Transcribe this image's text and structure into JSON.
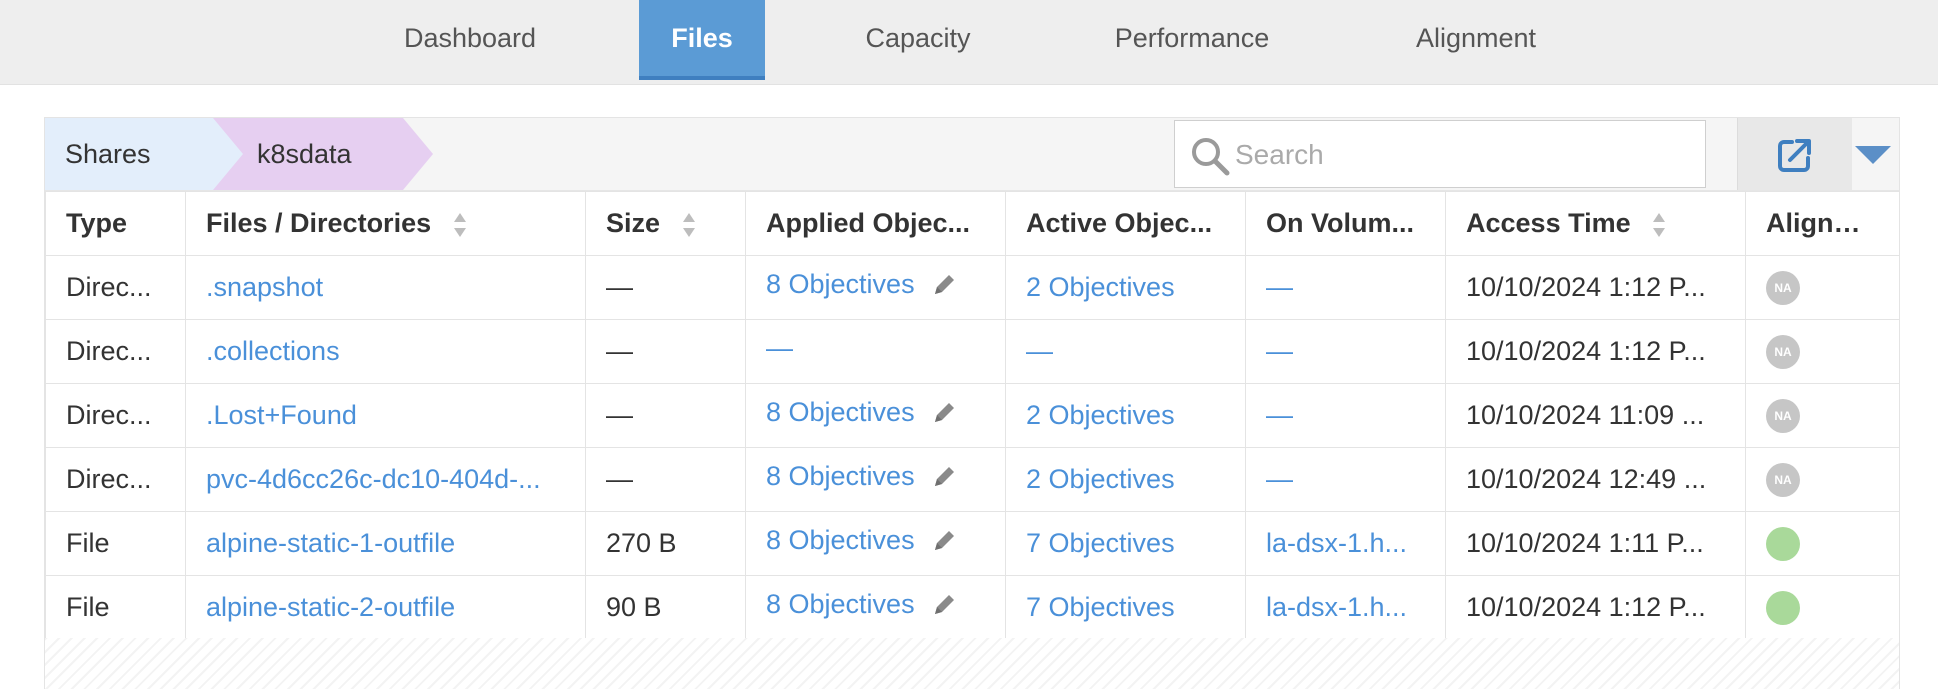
{
  "tabs": [
    {
      "label": "Dashboard",
      "active": false
    },
    {
      "label": "Files",
      "active": true
    },
    {
      "label": "Capacity",
      "active": false
    },
    {
      "label": "Performance",
      "active": false
    },
    {
      "label": "Alignment",
      "active": false
    }
  ],
  "breadcrumb": {
    "root": "Shares",
    "current": "k8sdata"
  },
  "search": {
    "placeholder": "Search",
    "value": ""
  },
  "columns": {
    "type": "Type",
    "files": "Files / Directories",
    "size": "Size",
    "applied": "Applied Objec...",
    "active": "Active Objec...",
    "on_volume": "On Volum...",
    "access_time": "Access Time",
    "alignment": "Alignm..."
  },
  "rows": [
    {
      "type": "Direc...",
      "name": ".snapshot",
      "size": "—",
      "applied": "8 Objectives",
      "active": "2 Objectives",
      "on_volume": "—",
      "access_time": "10/10/2024 1:12 P...",
      "alignment": "NA"
    },
    {
      "type": "Direc...",
      "name": ".collections",
      "size": "—",
      "applied": "—",
      "active": "—",
      "on_volume": "—",
      "access_time": "10/10/2024 1:12 P...",
      "alignment": "NA"
    },
    {
      "type": "Direc...",
      "name": ".Lost+Found",
      "size": "—",
      "applied": "8 Objectives",
      "active": "2 Objectives",
      "on_volume": "—",
      "access_time": "10/10/2024 11:09 ...",
      "alignment": "NA"
    },
    {
      "type": "Direc...",
      "name": "pvc-4d6cc26c-dc10-404d-...",
      "size": "—",
      "applied": "8 Objectives",
      "active": "2 Objectives",
      "on_volume": "—",
      "access_time": "10/10/2024 12:49 ...",
      "alignment": "NA"
    },
    {
      "type": "File",
      "name": "alpine-static-1-outfile",
      "size": "270 B",
      "applied": "8 Objectives",
      "active": "7 Objectives",
      "on_volume": "la-dsx-1.h...",
      "access_time": "10/10/2024 1:11 P...",
      "alignment": "ok"
    },
    {
      "type": "File",
      "name": "alpine-static-2-outfile",
      "size": "90 B",
      "applied": "8 Objectives",
      "active": "7 Objectives",
      "on_volume": "la-dsx-1.h...",
      "access_time": "10/10/2024 1:12 P...",
      "alignment": "ok"
    }
  ],
  "colors": {
    "accent": "#5b9bd5",
    "link": "#4a90d9",
    "aligned": "#a9d99a",
    "na_badge": "#c6c6c6"
  }
}
